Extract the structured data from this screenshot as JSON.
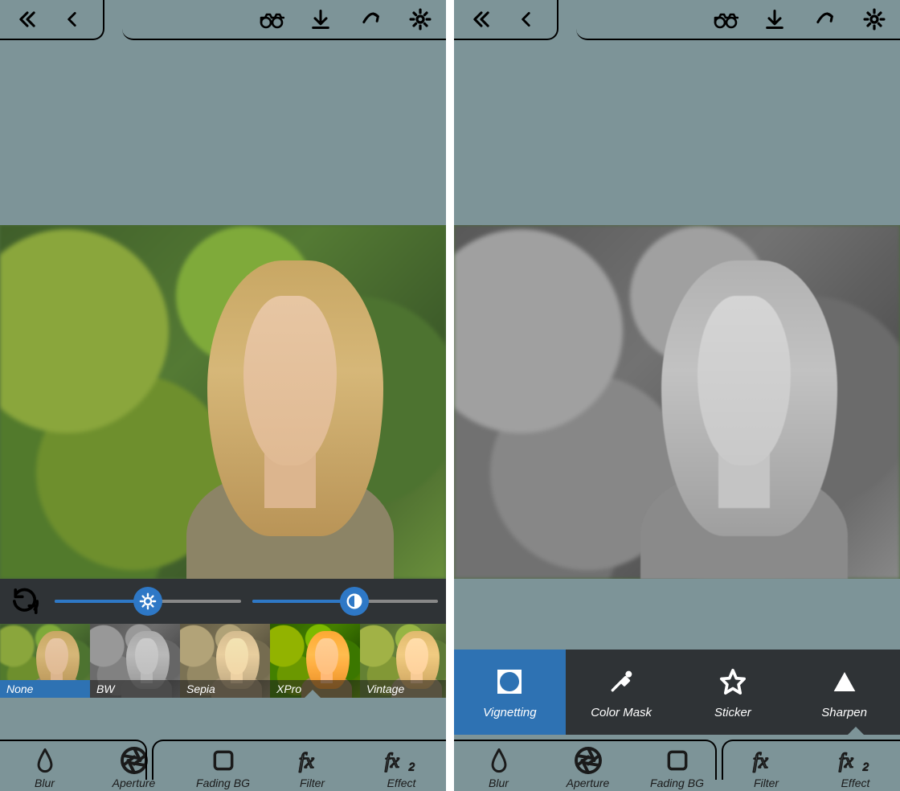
{
  "phones": {
    "left": {
      "slider_brightness_pct": 50,
      "slider_contrast_pct": 55,
      "filters": [
        "None",
        "BW",
        "Sepia",
        "XPro",
        "Vintage"
      ],
      "active_filter": "None"
    },
    "right": {
      "effects": [
        "Vignetting",
        "Color Mask",
        "Sticker",
        "Sharpen"
      ],
      "active_effect": "Vignetting"
    }
  },
  "bottom_tabs": [
    "Blur",
    "Aperture",
    "Fading BG",
    "Filter",
    "Effect"
  ],
  "left_active_tab": "Filter",
  "right_active_tab": "Effect",
  "top_actions": [
    "record",
    "download",
    "share",
    "settings"
  ],
  "colors": {
    "bg": "#7d9498",
    "accent": "#2e78c6",
    "panel": "#2f3336",
    "accent_dark": "#2e72b3"
  }
}
